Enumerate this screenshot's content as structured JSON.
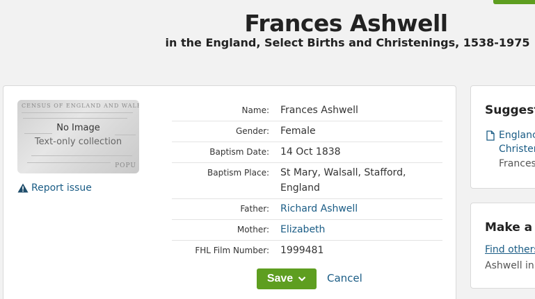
{
  "record": {
    "title": "Frances Ashwell",
    "subtitle": "in the England, Select Births and Christenings, 1538-1975"
  },
  "image": {
    "doc_header": "CENSUS OF ENGLAND AND WALES",
    "doc_footer": "POPU",
    "no_image": "No Image",
    "collection_note": "Text-only collection"
  },
  "report_issue": "Report issue",
  "facts": [
    {
      "label": "Name:",
      "value": "Frances Ashwell",
      "is_link": false
    },
    {
      "label": "Gender:",
      "value": "Female",
      "is_link": false
    },
    {
      "label": "Baptism Date:",
      "value": "14 Oct 1838",
      "is_link": false
    },
    {
      "label": "Baptism Place:",
      "value": "St Mary, Walsall, Stafford, England",
      "is_link": false
    },
    {
      "label": "Father:",
      "value": "Richard Ashwell",
      "is_link": true
    },
    {
      "label": "Mother:",
      "value": "Elizabeth",
      "is_link": true
    },
    {
      "label": "FHL Film Number:",
      "value": "1999481",
      "is_link": false
    }
  ],
  "actions": {
    "save_label": "Save",
    "cancel_label": "Cancel"
  },
  "suggested": {
    "title": "Suggeste",
    "line1": "Englanc",
    "line2": "Christer",
    "line3": "Frances"
  },
  "make_connection": {
    "title": "Make a C",
    "link": "Find others",
    "text": "Ashwell in"
  },
  "colors": {
    "accent_green": "#5e9e20",
    "link_blue": "#1a5c85"
  }
}
